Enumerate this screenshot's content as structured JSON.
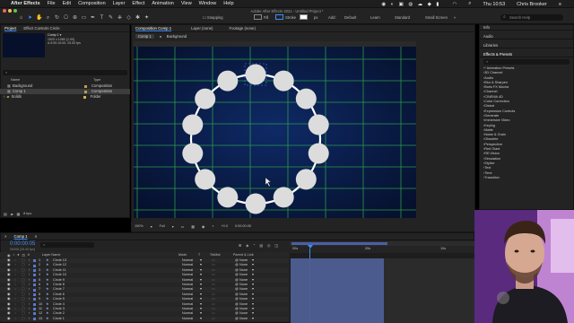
{
  "menubar": {
    "apple": "",
    "app": "After Effects",
    "items": [
      "File",
      "Edit",
      "Composition",
      "Layer",
      "Effect",
      "Animation",
      "View",
      "Window",
      "Help"
    ],
    "clock": "Thu 10:53",
    "user": "Chris Brooker"
  },
  "window_title": "Adobe After Effects 2021 - Untitled Project *",
  "toolbar": {
    "snapping": "Snapping",
    "fill": "Fill",
    "stroke": "Stroke",
    "stroke_width": "px",
    "add": "Add:",
    "workspaces": [
      "Default",
      "Learn",
      "Standard",
      "Small Screen"
    ],
    "search_help": "Search Help",
    "fill_color": "#ffffff",
    "stroke_color": "#ffffff"
  },
  "project_panel": {
    "tabs": [
      "Project",
      "Effect Controls Circle"
    ],
    "comp_name": "Comp 1 ▾",
    "info_lines": [
      "1920 x 1080 (1.00)",
      "Δ 0:00:10:00, 25.00 fps"
    ],
    "search_placeholder": "",
    "columns": [
      "Name",
      "Type"
    ],
    "items": [
      {
        "name": "Background",
        "type": "Composition",
        "label_color": "#b9a04e",
        "selected": false
      },
      {
        "name": "Comp 1",
        "type": "Composition",
        "label_color": "#b9a04e",
        "selected": true
      },
      {
        "name": "Solids",
        "type": "Folder",
        "label_color": "#c7b45a",
        "selected": false
      }
    ],
    "bpc": "8 bpc"
  },
  "comp_panel": {
    "tabs": [
      "Composition Comp 1",
      "Layer (none)",
      "Footage (none)"
    ],
    "breadcrumbs": [
      "Comp 1",
      "Background"
    ],
    "zoom": "100%",
    "resolution": "Full",
    "exposure": "+0.0",
    "timecode": "0:00:00:05",
    "circle_count": 14
  },
  "right_panel": {
    "sections": [
      "Info",
      "Audio",
      "Libraries"
    ],
    "effects_title": "Effects & Presets",
    "search_placeholder": "",
    "effects": [
      "* Animation Presets",
      "3D Channel",
      "Audio",
      "Blur & Sharpen",
      "Boris FX Mocha",
      "Channel",
      "CINEMA 4D",
      "Color Correction",
      "Distort",
      "Expression Controls",
      "Generate",
      "Immersive Video",
      "Keying",
      "Matte",
      "Noise & Grain",
      "Obsolete",
      "Perspective",
      "Red Giant",
      "RE:Vision",
      "Simulation",
      "Stylize",
      "Text",
      "Time",
      "Transition"
    ]
  },
  "timeline": {
    "tab": "Comp 1",
    "timecode": "0:00:00:05",
    "timecode_sub": "00005 (25.00 fps)",
    "columns": [
      "#",
      "Layer Name",
      "Mode",
      "T",
      "TrkMat",
      "Parent & Link"
    ],
    "ruler": [
      "00s",
      "05s",
      "10s"
    ],
    "layers": [
      {
        "num": "1",
        "name": "Circle 13",
        "mode": "Normal",
        "parent": "None"
      },
      {
        "num": "2",
        "name": "Circle 12",
        "mode": "Normal",
        "parent": "None"
      },
      {
        "num": "3",
        "name": "Circle 11",
        "mode": "Normal",
        "parent": "None"
      },
      {
        "num": "4",
        "name": "Circle 10",
        "mode": "Normal",
        "parent": "None"
      },
      {
        "num": "5",
        "name": "Circle 9",
        "mode": "Normal",
        "parent": "None"
      },
      {
        "num": "6",
        "name": "Circle 8",
        "mode": "Normal",
        "parent": "None"
      },
      {
        "num": "7",
        "name": "Circle 7",
        "mode": "Normal",
        "parent": "None"
      },
      {
        "num": "8",
        "name": "Circle 6",
        "mode": "Normal",
        "parent": "None"
      },
      {
        "num": "9",
        "name": "Circle 5",
        "mode": "Normal",
        "parent": "None"
      },
      {
        "num": "10",
        "name": "Circle 4",
        "mode": "Normal",
        "parent": "None"
      },
      {
        "num": "11",
        "name": "Circle 3",
        "mode": "Normal",
        "parent": "None"
      },
      {
        "num": "12",
        "name": "Circle 2",
        "mode": "Normal",
        "parent": "None"
      },
      {
        "num": "13",
        "name": "Circle 1",
        "mode": "Normal",
        "parent": "None"
      }
    ]
  }
}
